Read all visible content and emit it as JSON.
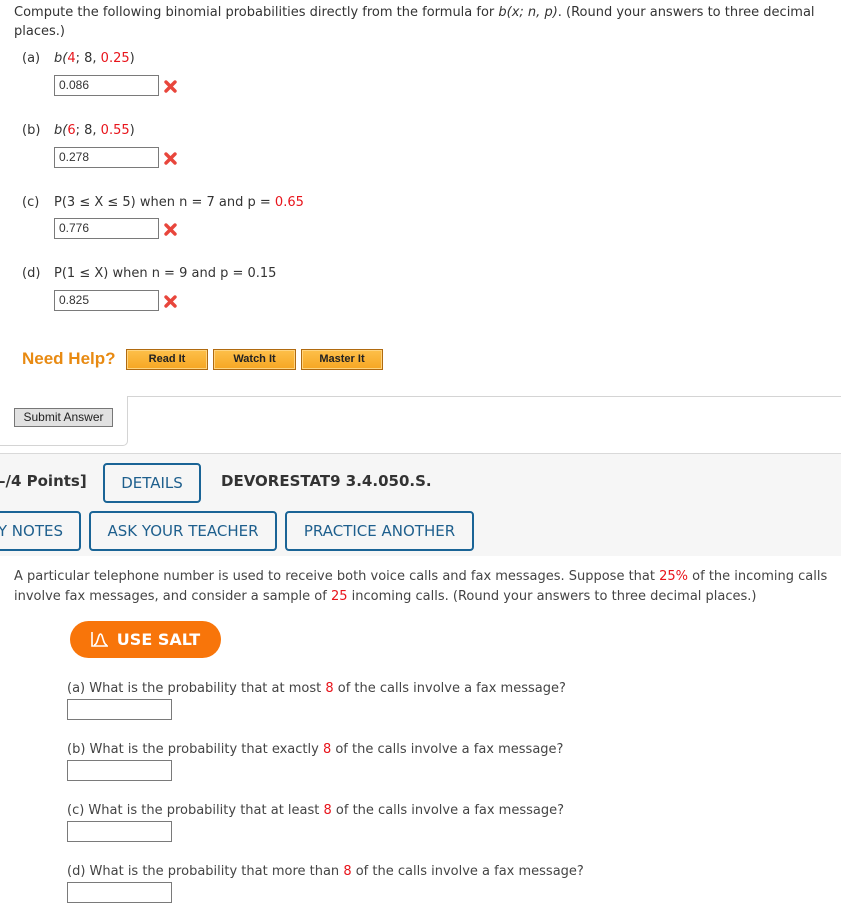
{
  "problem1": {
    "intro_pre": "Compute the following binomial probabilities directly from the formula for ",
    "intro_formula": "b(x; n, p)",
    "intro_post": ". (Round your answers to three decimal places.)",
    "parts": [
      {
        "tag": "(a)",
        "fn": "b(",
        "x": "4",
        "sep": "; 8, ",
        "p": "0.25",
        "close": ")",
        "answer": "0.086",
        "status": "incorrect"
      },
      {
        "tag": "(b)",
        "fn": "b(",
        "x": "6",
        "sep": "; 8, ",
        "p": "0.55",
        "close": ")",
        "answer": "0.278",
        "status": "incorrect"
      },
      {
        "tag": "(c)",
        "expr": "P(3 ≤ X ≤ 5) when n = 7 and p = ",
        "p": "0.65",
        "answer": "0.776",
        "status": "incorrect"
      },
      {
        "tag": "(d)",
        "expr": "P(1 ≤ X) when n = 9 and p = 0.15",
        "answer": "0.825",
        "status": "incorrect"
      }
    ],
    "need_help": "Need Help?",
    "help_buttons": [
      "Read It",
      "Watch It",
      "Master It"
    ],
    "submit_label": "Submit Answer"
  },
  "problem2": {
    "points": "–/4 Points]",
    "details_label": "DETAILS",
    "code": "DEVORESTAT9 3.4.050.S.",
    "notes_label": "Y NOTES",
    "ask_teacher_label": "ASK YOUR TEACHER",
    "practice_label": "PRACTICE ANOTHER",
    "text_1": "A particular telephone number is used to receive both voice calls and fax messages. Suppose that ",
    "pct": "25%",
    "text_2": " of the incoming calls involve fax messages, and consider a sample of ",
    "n": "25",
    "text_3": " incoming calls. (Round your answers to three decimal places.)",
    "salt_label": "USE SALT",
    "questions": [
      {
        "pre": "(a) What is the probability that at most ",
        "k": "8",
        "post": " of the calls involve a fax message?",
        "answer": ""
      },
      {
        "pre": "(b) What is the probability that exactly ",
        "k": "8",
        "post": " of the calls involve a fax message?",
        "answer": ""
      },
      {
        "pre": "(c) What is the probability that at least ",
        "k": "8",
        "post": " of the calls involve a fax message?",
        "answer": ""
      },
      {
        "pre": "(d) What is the probability that more than ",
        "k": "8",
        "post": " of the calls involve a fax message?",
        "answer": ""
      }
    ]
  },
  "colors": {
    "accent_red": "#e8141b",
    "salt_orange": "#f8750a",
    "link_blue": "#1e5f8d",
    "help_orange": "#e88a12"
  }
}
